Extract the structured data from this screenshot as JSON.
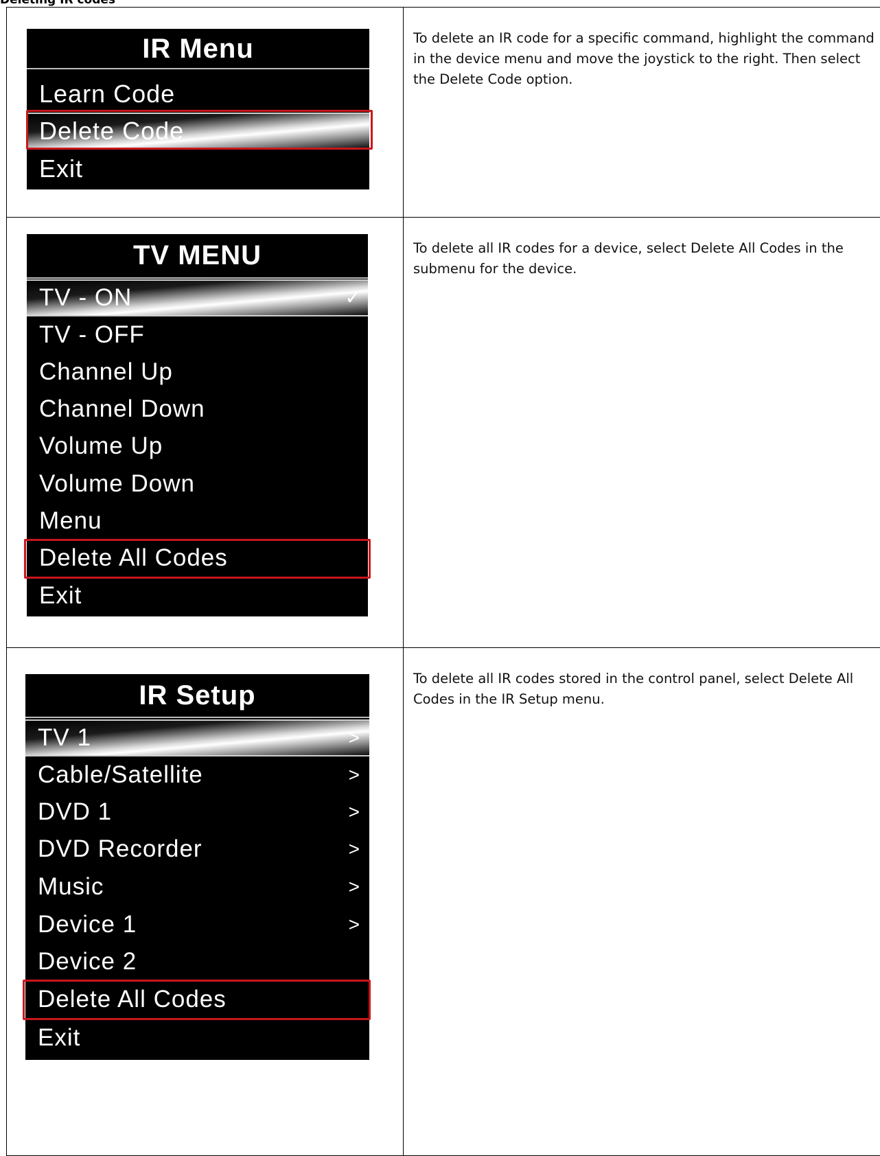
{
  "heading": "Deleting IR codes",
  "rows": [
    {
      "screen": {
        "title": "IR Menu",
        "items": [
          {
            "label": "Learn Code"
          },
          {
            "label": "Delete Code"
          },
          {
            "label": "Exit"
          }
        ]
      },
      "description": "To delete an IR code for a specific command, highlight the command in the device menu and move the joystick to the right. Then select the Delete Code option."
    },
    {
      "screen": {
        "title": "TV MENU",
        "items": [
          {
            "label": "TV - ON",
            "indicator": "✓"
          },
          {
            "label": "TV - OFF"
          },
          {
            "label": "Channel Up"
          },
          {
            "label": "Channel Down"
          },
          {
            "label": "Volume Up"
          },
          {
            "label": "Volume Down"
          },
          {
            "label": "Menu"
          },
          {
            "label": "Delete All Codes"
          },
          {
            "label": "Exit"
          }
        ]
      },
      "description": "To delete all IR codes for a device, select Delete All Codes in the submenu for the device."
    },
    {
      "screen": {
        "title": "IR Setup",
        "items": [
          {
            "label": "TV 1",
            "indicator": ">"
          },
          {
            "label": "Cable/Satellite",
            "indicator": ">"
          },
          {
            "label": "DVD 1",
            "indicator": ">"
          },
          {
            "label": "DVD Recorder",
            "indicator": ">"
          },
          {
            "label": "Music",
            "indicator": ">"
          },
          {
            "label": "Device 1",
            "indicator": ">"
          },
          {
            "label": "Device 2"
          },
          {
            "label": "Delete All Codes"
          },
          {
            "label": "Exit"
          }
        ]
      },
      "description": "To delete all IR codes stored in the control panel, select Delete All Codes in the IR Setup menu."
    }
  ],
  "colors": {
    "screen_background": "#000000",
    "screen_text": "#ffffff",
    "callout_border": "#c8171c"
  }
}
